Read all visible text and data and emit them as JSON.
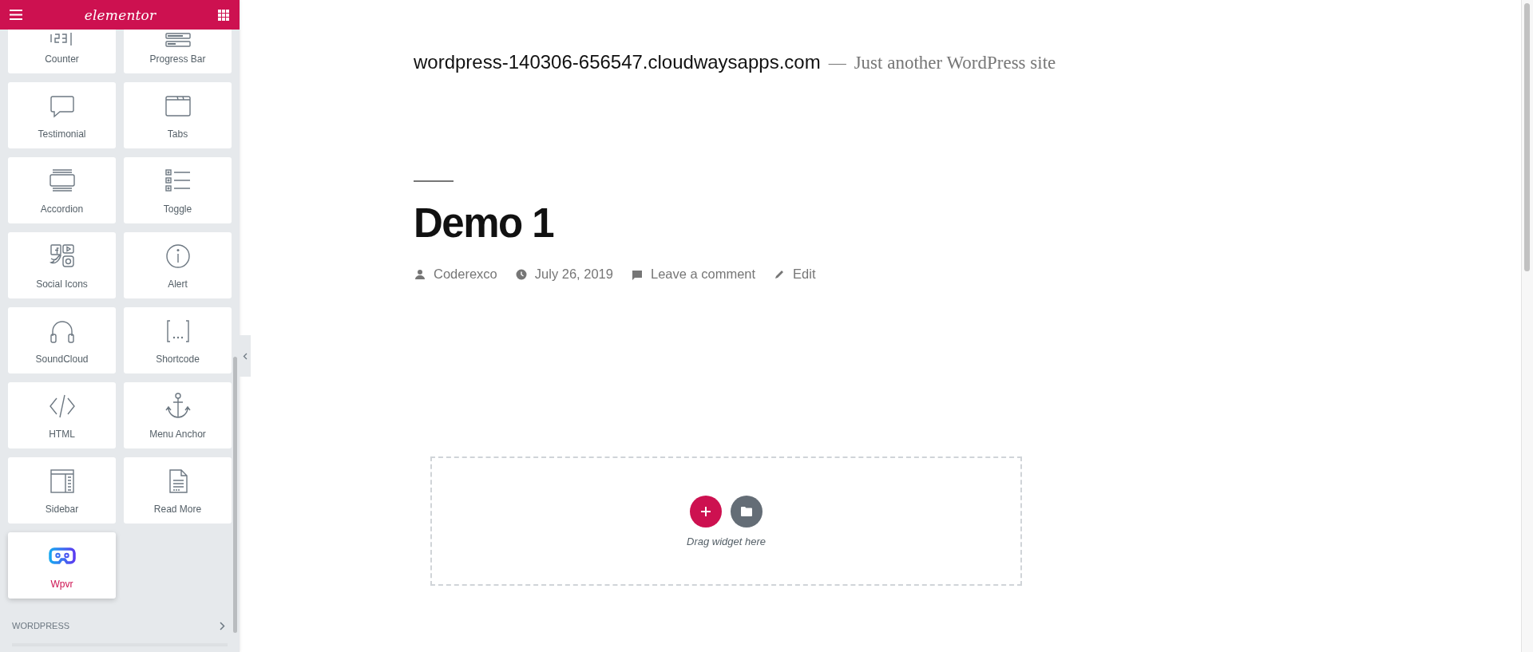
{
  "header": {
    "logo": "elementor"
  },
  "widgets": [
    {
      "label": "Counter",
      "selected": false
    },
    {
      "label": "Progress Bar",
      "selected": false
    },
    {
      "label": "Testimonial",
      "selected": false
    },
    {
      "label": "Tabs",
      "selected": false
    },
    {
      "label": "Accordion",
      "selected": false
    },
    {
      "label": "Toggle",
      "selected": false
    },
    {
      "label": "Social Icons",
      "selected": false
    },
    {
      "label": "Alert",
      "selected": false
    },
    {
      "label": "SoundCloud",
      "selected": false
    },
    {
      "label": "Shortcode",
      "selected": false
    },
    {
      "label": "HTML",
      "selected": false
    },
    {
      "label": "Menu Anchor",
      "selected": false
    },
    {
      "label": "Sidebar",
      "selected": false
    },
    {
      "label": "Read More",
      "selected": false
    },
    {
      "label": "Wpvr",
      "selected": true
    }
  ],
  "category": {
    "label": "WORDPRESS"
  },
  "site": {
    "title": "wordpress-140306-656547.cloudwaysapps.com",
    "separator": "—",
    "tagline": "Just another WordPress site"
  },
  "post": {
    "title": "Demo 1",
    "meta": [
      {
        "kind": "author",
        "text": "Coderexco"
      },
      {
        "kind": "date",
        "text": "July 26, 2019"
      },
      {
        "kind": "comments",
        "text": "Leave a comment"
      },
      {
        "kind": "edit",
        "text": "Edit"
      }
    ]
  },
  "dropzone": {
    "hint": "Drag widget here"
  }
}
